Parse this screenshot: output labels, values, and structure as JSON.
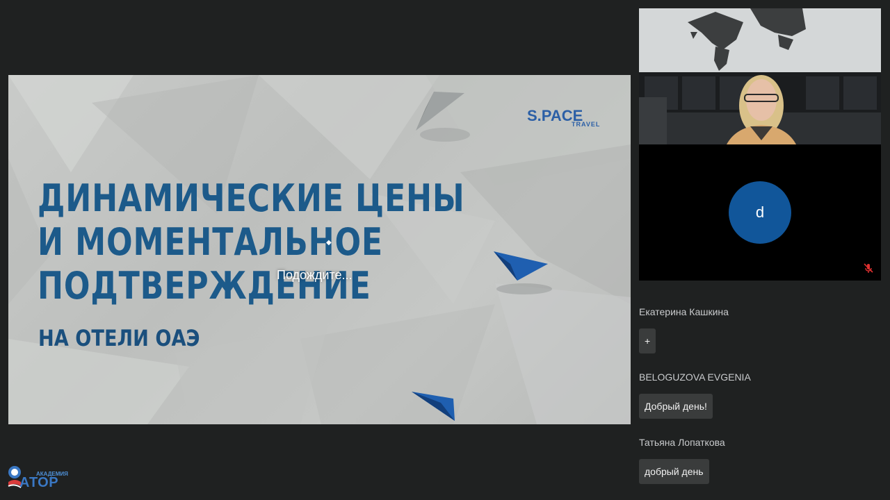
{
  "slide": {
    "logo_main": "S.PACE",
    "logo_sub": "TRAVEL",
    "headline_lines": [
      "ДИНАМИЧЕСКИЕ ЦЕНЫ",
      "И МОМЕНТАЛЬНОЕ",
      "ПОДТВЕРЖДЕНИЕ"
    ],
    "subline": "НА ОТЕЛИ ОАЭ",
    "loading": "Подождите..."
  },
  "participant": {
    "avatar_letter": "d"
  },
  "chat": {
    "messages": [
      {
        "author": "Екатерина Кашкина",
        "text": "+"
      },
      {
        "author": "BELOGUZOVA EVGENIA",
        "text": "Добрый день!"
      },
      {
        "author": "Татьяна Лопаткова",
        "text": "добрый день"
      }
    ]
  },
  "footer_logo": {
    "small": "АКАДЕМИЯ",
    "big": "АТОР"
  },
  "colors": {
    "background": "#1f2121",
    "headline": "#1c5a8a",
    "avatar": "#11569a",
    "bubble": "#3a3c3c",
    "mic_muted": "#e03030"
  },
  "icons": [
    "paper-plane-icon",
    "mic-off-icon",
    "ator-globe-icon"
  ]
}
